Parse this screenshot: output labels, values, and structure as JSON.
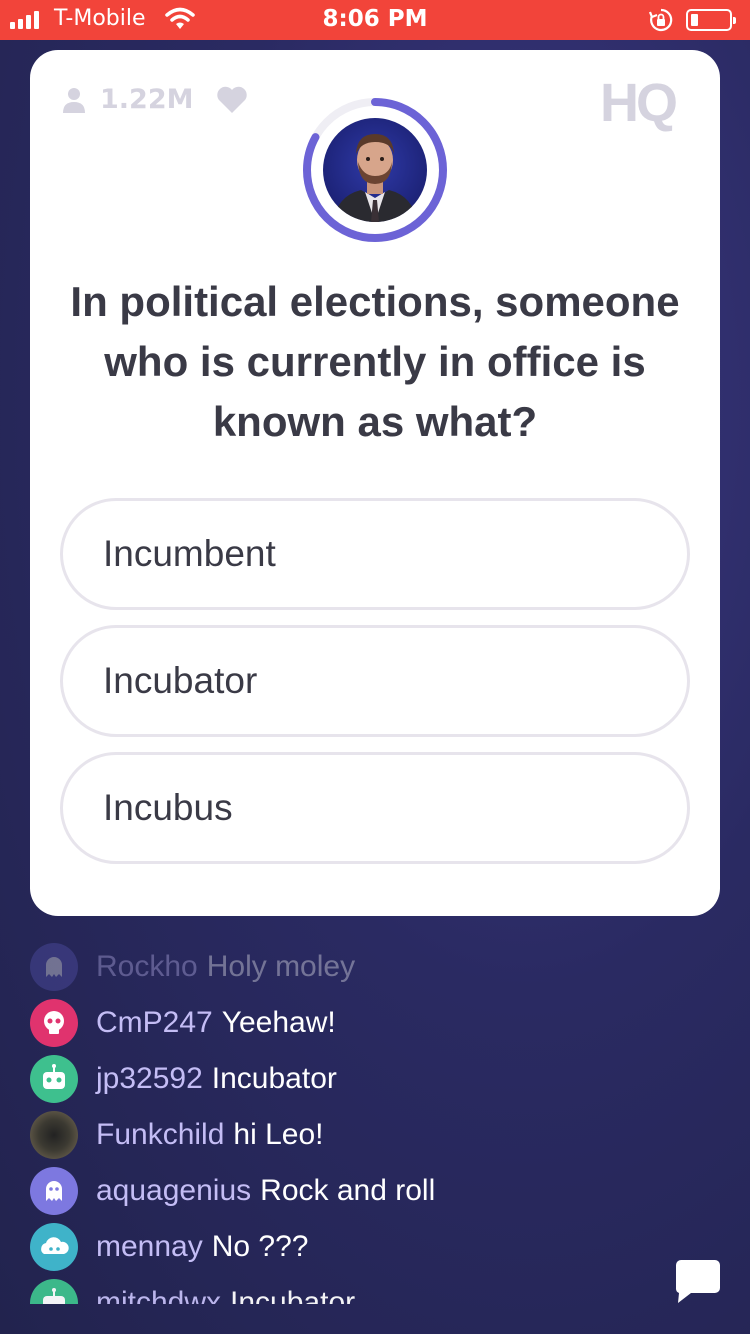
{
  "status_bar": {
    "carrier": "T-Mobile",
    "time": "8:06 PM",
    "battery_level": 0.2
  },
  "game": {
    "viewer_count": "1.22M",
    "logo": "HQ",
    "timer_progress": 0.83,
    "question": "In political elections, someone who is currently in office is known as what?",
    "answers": [
      "Incumbent",
      "Incubator",
      "Incubus"
    ]
  },
  "chat": {
    "messages": [
      {
        "user": "Rockho",
        "text": "Holy moley",
        "avatar_color": "#5a59b8",
        "icon": "ghost-icon"
      },
      {
        "user": "CmP247",
        "text": "Yeehaw!",
        "avatar_color": "#e0336e",
        "icon": "skull-icon"
      },
      {
        "user": "jp32592",
        "text": "Incubator",
        "avatar_color": "#3ec08e",
        "icon": "robot-icon"
      },
      {
        "user": "Funkchild",
        "text": "hi Leo!",
        "avatar_color": "#4a4a3c",
        "icon": "photo-avatar"
      },
      {
        "user": "aquagenius",
        "text": "Rock and roll",
        "avatar_color": "#7d78e0",
        "icon": "ghost-icon"
      },
      {
        "user": "mennay",
        "text": "No ???",
        "avatar_color": "#3fb3c9",
        "icon": "cloud-icon"
      },
      {
        "user": "mitchdwx",
        "text": "Incubator",
        "avatar_color": "#3ec08e",
        "icon": "robot-icon"
      }
    ]
  },
  "colors": {
    "status_bar": "#f2443a",
    "timer_ring": "#6c63d6",
    "background": "#2a2a62",
    "username": "#c4bdf5"
  }
}
